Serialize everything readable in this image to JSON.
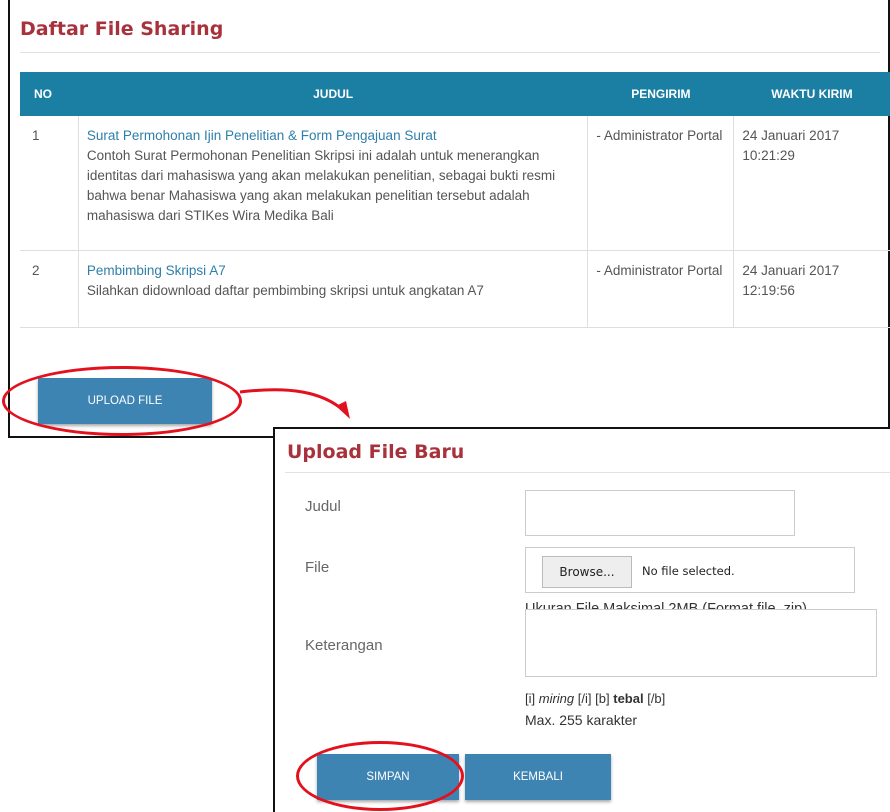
{
  "list": {
    "title": "Daftar File Sharing",
    "columns": [
      "NO",
      "JUDUL",
      "PENGIRIM",
      "WAKTU KIRIM"
    ],
    "rows": [
      {
        "no": "1",
        "title": "Surat Permohonan Ijin Penelitian & Form Pengajuan Surat",
        "desc": "Contoh Surat Permohonan Penelitian Skripsi ini adalah untuk menerangkan identitas dari mahasiswa yang akan melakukan penelitian, sebagai bukti resmi bahwa benar Mahasiswa yang akan melakukan penelitian tersebut adalah mahasiswa dari STIKes Wira Medika Bali",
        "sender": "- Administrator Portal",
        "date": "24 Januari 2017",
        "time": "10:21:29"
      },
      {
        "no": "2",
        "title": "Pembimbing Skripsi A7",
        "desc": "Silahkan didownload daftar pembimbing skripsi untuk angkatan A7",
        "sender": "- Administrator Portal",
        "date": "24 Januari 2017",
        "time": "12:19:56"
      }
    ],
    "upload_button": "UPLOAD FILE"
  },
  "form": {
    "title": "Upload File Baru",
    "judul_label": "Judul",
    "judul_value": "",
    "file_label": "File",
    "browse_label": "Browse...",
    "no_file": "No file selected.",
    "file_hint": "Ukuran File Maksimal 2MB (Format file .zip)",
    "keterangan_label": "Keterangan",
    "keterangan_value": "",
    "fmt_italic_open": "[i]",
    "fmt_italic_word": "miring",
    "fmt_italic_close": "[/i]",
    "fmt_bold_open": "[b]",
    "fmt_bold_word": "tebal",
    "fmt_bold_close": "[/b]",
    "max_chars": "Max. 255 karakter",
    "save_button": "SIMPAN",
    "back_button": "KEMBALI"
  },
  "colors": {
    "accent": "#1a7fa3",
    "title": "#a8323c",
    "button": "#3d84b3",
    "highlight": "#e3111e"
  }
}
